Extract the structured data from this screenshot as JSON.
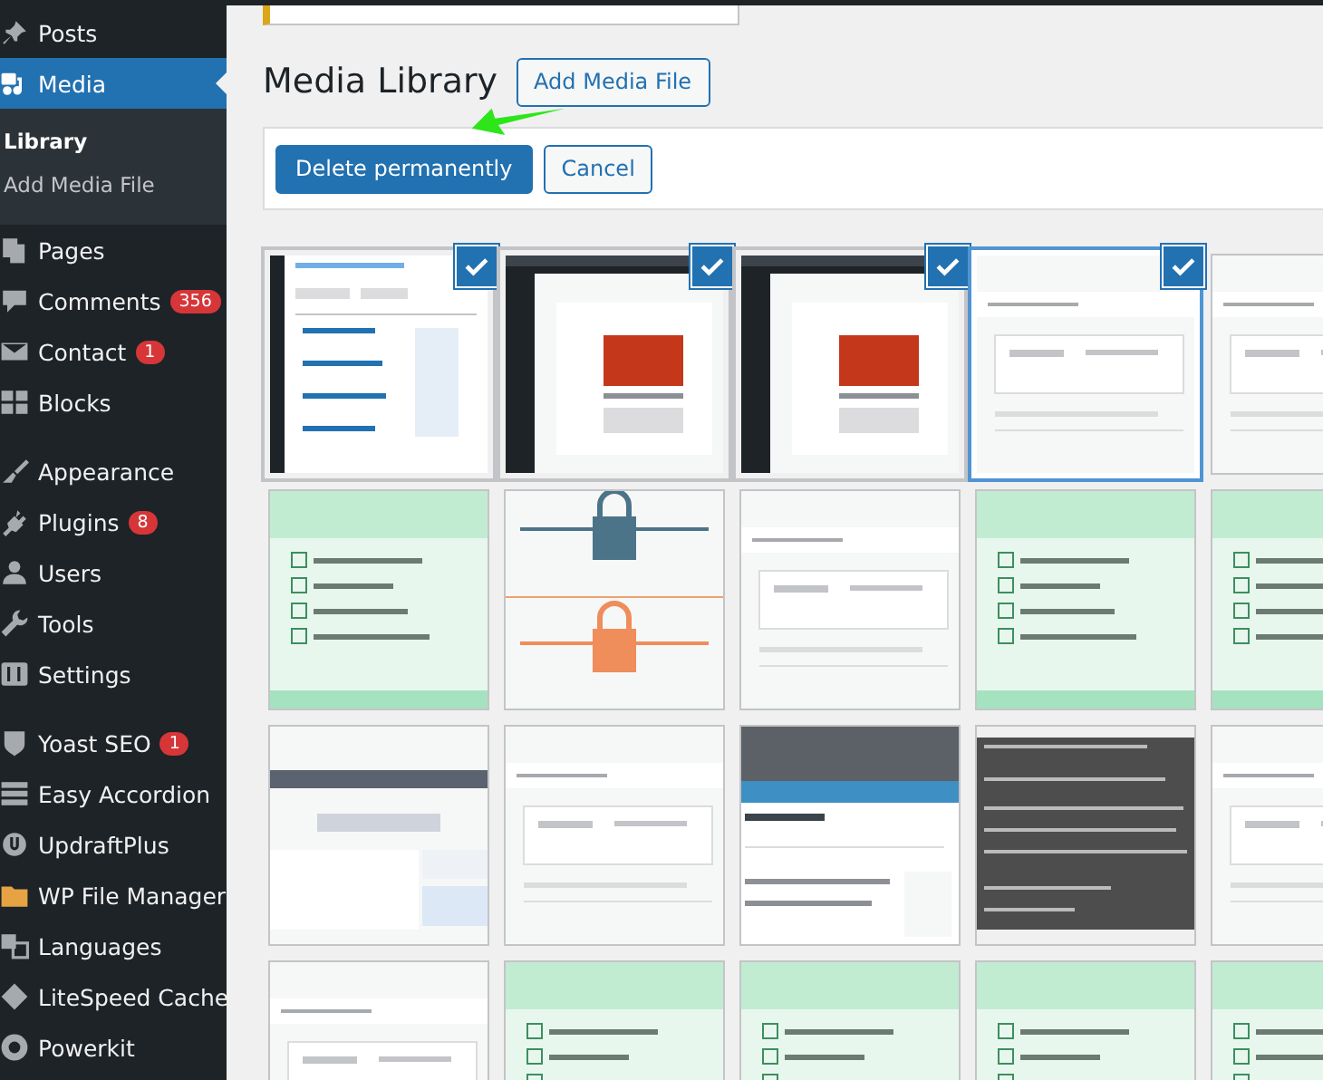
{
  "sidebar": {
    "menu_groups": [
      [
        {
          "label": "Posts",
          "selected": false
        },
        {
          "label": "Media",
          "selected": true,
          "children": [
            {
              "label": "Library",
              "selected": true
            },
            {
              "label": "Add Media File",
              "selected": false
            }
          ]
        },
        {
          "label": "Pages",
          "selected": false
        },
        {
          "label": "Comments",
          "selected": false,
          "badge": "356"
        },
        {
          "label": "Contact",
          "selected": false,
          "badge": "1"
        },
        {
          "label": "Blocks",
          "selected": false
        }
      ],
      [
        {
          "label": "Appearance",
          "selected": false
        },
        {
          "label": "Plugins",
          "selected": false,
          "badge": "8"
        },
        {
          "label": "Users",
          "selected": false
        },
        {
          "label": "Tools",
          "selected": false
        },
        {
          "label": "Settings",
          "selected": false
        }
      ],
      [
        {
          "label": "Yoast SEO",
          "selected": false,
          "badge": "1"
        },
        {
          "label": "Easy Accordion",
          "selected": false
        },
        {
          "label": "UpdraftPlus",
          "selected": false
        },
        {
          "label": "WP File Manager",
          "selected": false
        },
        {
          "label": "Languages",
          "selected": false
        },
        {
          "label": "LiteSpeed Cache",
          "selected": false
        },
        {
          "label": "Powerkit",
          "selected": false
        }
      ]
    ]
  },
  "header": {
    "title": "Media Library",
    "add_button": "Add Media File"
  },
  "bulk_toolbar": {
    "delete_button": "Delete permanently",
    "cancel_button": "Cancel"
  },
  "attachments": [
    {
      "kind": "picture",
      "selected": true,
      "focused": false
    },
    {
      "kind": "picture",
      "selected": true,
      "focused": false
    },
    {
      "kind": "picture",
      "selected": true,
      "focused": false
    },
    {
      "kind": "picture",
      "selected": true,
      "focused": true
    },
    {
      "kind": "picture",
      "selected": false,
      "focused": false
    },
    {
      "kind": "picture",
      "selected": false,
      "focused": false
    },
    {
      "kind": "picture",
      "selected": false,
      "focused": false
    },
    {
      "kind": "picture",
      "selected": false,
      "focused": false
    },
    {
      "kind": "picture",
      "selected": false,
      "focused": false
    },
    {
      "kind": "picture",
      "selected": false,
      "focused": false
    },
    {
      "kind": "picture",
      "selected": false,
      "focused": false
    },
    {
      "kind": "picture",
      "selected": false,
      "focused": false
    },
    {
      "kind": "picture",
      "selected": false,
      "focused": false
    },
    {
      "kind": "picture",
      "selected": false,
      "focused": false
    },
    {
      "kind": "picture",
      "selected": false,
      "focused": false
    },
    {
      "kind": "picture",
      "selected": false,
      "focused": false
    },
    {
      "kind": "picture",
      "selected": false,
      "focused": false
    },
    {
      "kind": "picture",
      "selected": false,
      "focused": false
    },
    {
      "kind": "picture",
      "selected": false,
      "focused": false
    },
    {
      "kind": "picture",
      "selected": false,
      "focused": false
    }
  ]
}
